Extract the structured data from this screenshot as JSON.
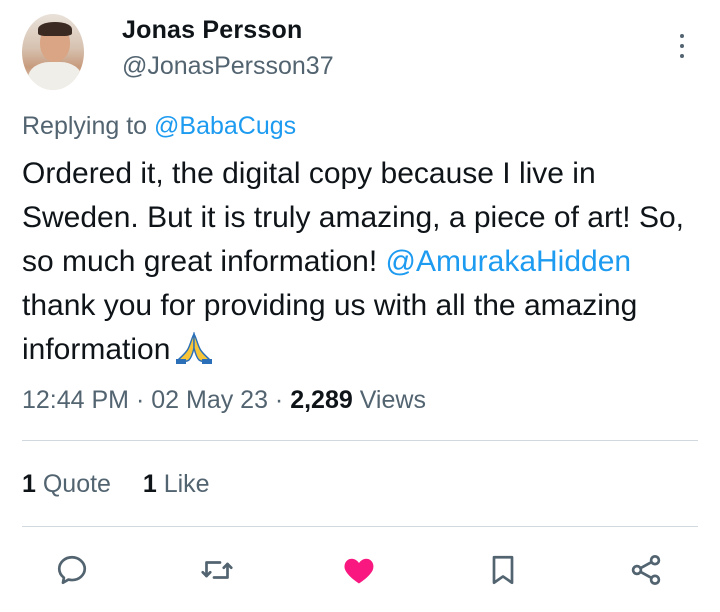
{
  "user": {
    "name": "Jonas Persson",
    "handle": "@JonasPersson37"
  },
  "reply": {
    "prefix": "Replying to",
    "mention": "@BabaCugs"
  },
  "tweet": {
    "text_1": "Ordered it, the digital copy because I live in Sweden. But it is truly amazing, a piece of art! So, so much great information!",
    "mention": "@AmurakaHidden",
    "text_2": " thank you for providing us with all the amazing information",
    "emoji": "folded-hands-emoji"
  },
  "meta": {
    "time": "12:44 PM",
    "sep1": " · ",
    "date": "02 May 23",
    "sep2": " · ",
    "views_count": "2,289",
    "views_label": " Views"
  },
  "stats": {
    "quotes_count": "1",
    "quotes_label": " Quote",
    "likes_count": "1",
    "likes_label": " Like"
  },
  "actions": {
    "reply_icon": "reply-icon",
    "retweet_icon": "retweet-icon",
    "like_icon": "heart-icon",
    "bookmark_icon": "bookmark-icon",
    "share_icon": "share-icon"
  },
  "colors": {
    "link": "#1d9bf0",
    "secondary": "#536471",
    "like": "#f91880",
    "icon": "#536471"
  }
}
